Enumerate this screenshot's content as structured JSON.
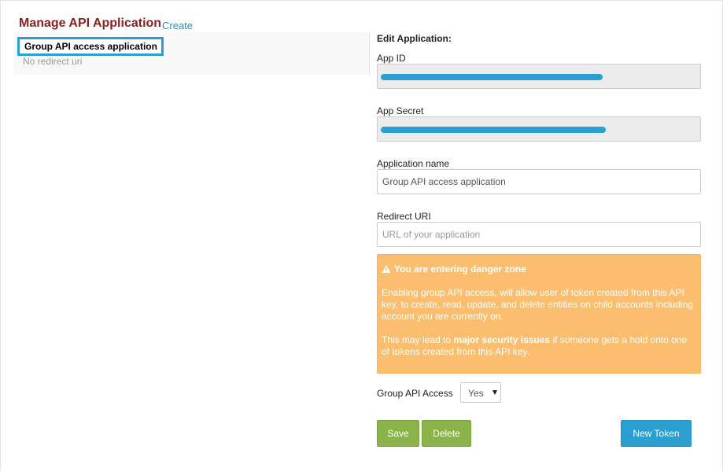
{
  "header": {
    "title": "Manage API Application",
    "create_link": "Create"
  },
  "app_list": {
    "items": [
      {
        "name": "Group API access application",
        "redirect": "No redirect uri"
      }
    ]
  },
  "edit": {
    "heading": "Edit Application:",
    "app_id_label": "App ID",
    "app_secret_label": "App Secret",
    "app_name_label": "Application name",
    "app_name_value": "Group API access application",
    "redirect_label": "Redirect URI",
    "redirect_placeholder": "URL of your application",
    "warning": {
      "title": "You are entering danger zone",
      "text1": "Enabling group API access, will allow user of token created from this API key, to create, read, update, and delete entities on child accounts including account you are currently on.",
      "text2_prefix": "This may lead to ",
      "text2_bold": "major security issues",
      "text2_suffix": " if someone gets a hold onto one of tokens created from this API key."
    },
    "group_access_label": "Group API Access",
    "group_access_value": "Yes",
    "save_label": "Save",
    "delete_label": "Delete",
    "new_token_label": "New Token"
  },
  "colors": {
    "title": "#8b1f1f",
    "link": "#3a87ad",
    "highlight": "#2b9fd1",
    "warning_bg": "#fbbd6e",
    "success_button": "#8ab34a",
    "info_button": "#2b9fd1"
  }
}
